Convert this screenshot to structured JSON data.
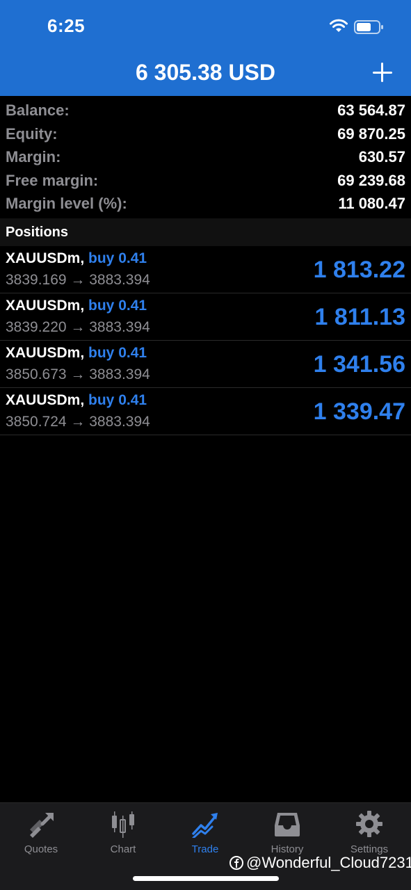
{
  "status_bar": {
    "time": "6:25"
  },
  "header": {
    "title": "6 305.38 USD"
  },
  "summary": [
    {
      "label": "Balance:",
      "value": "63 564.87"
    },
    {
      "label": "Equity:",
      "value": "69 870.25"
    },
    {
      "label": "Margin:",
      "value": "630.57"
    },
    {
      "label": "Free margin:",
      "value": "69 239.68"
    },
    {
      "label": "Margin level (%):",
      "value": "11 080.47"
    }
  ],
  "positions_section": {
    "title": "Positions"
  },
  "positions": [
    {
      "symbol": "XAUUSDm,",
      "type": "buy 0.41",
      "prices": "3839.169 → 3883.394",
      "profit": "1 813.22"
    },
    {
      "symbol": "XAUUSDm,",
      "type": "buy 0.41",
      "prices": "3839.220 → 3883.394",
      "profit": "1 811.13"
    },
    {
      "symbol": "XAUUSDm,",
      "type": "buy 0.41",
      "prices": "3850.673 → 3883.394",
      "profit": "1 341.56"
    },
    {
      "symbol": "XAUUSDm,",
      "type": "buy 0.41",
      "prices": "3850.724 → 3883.394",
      "profit": "1 339.47"
    }
  ],
  "tabs": [
    {
      "label": "Quotes",
      "icon": "quotes-icon"
    },
    {
      "label": "Chart",
      "icon": "candlestick-chart-icon"
    },
    {
      "label": "Trade",
      "icon": "trade-icon",
      "active": true
    },
    {
      "label": "History",
      "icon": "inbox-history-icon"
    },
    {
      "label": "Settings",
      "icon": "gear-icon"
    }
  ],
  "watermark": {
    "text": "@Wonderful_Cloud7231"
  },
  "colors": {
    "header_bg": "#1f6fd1",
    "accent_blue": "#2f80ed",
    "label_gray": "#8e8e93",
    "background": "#000000"
  }
}
